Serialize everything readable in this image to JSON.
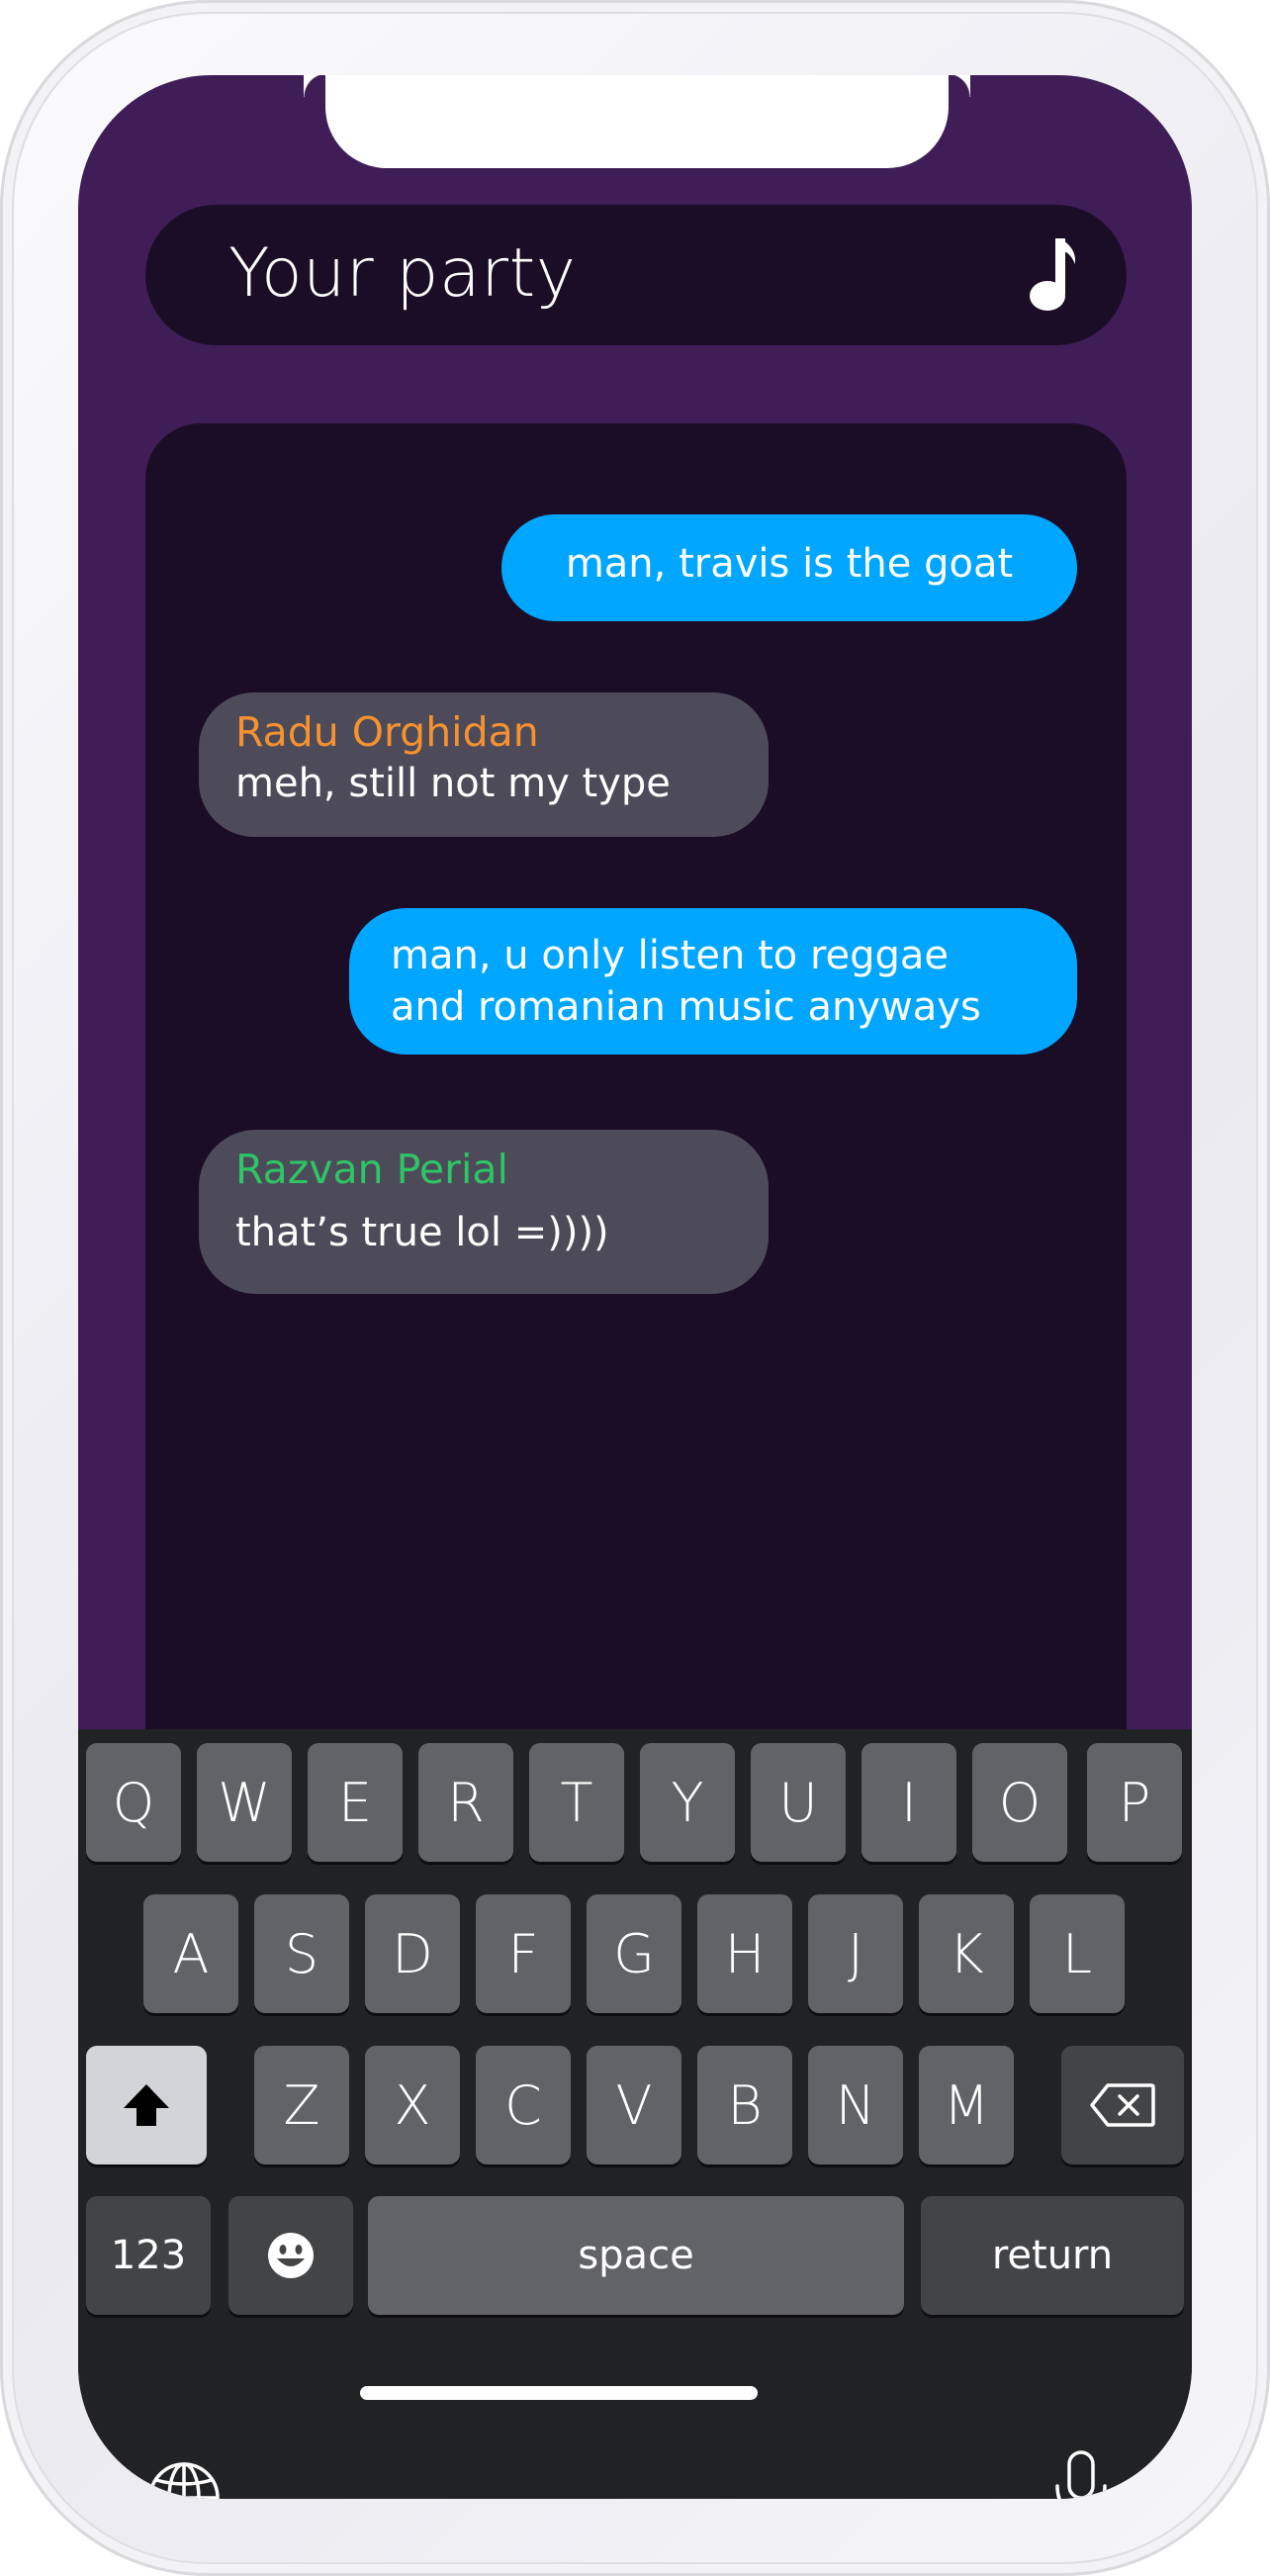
{
  "header": {
    "title": "Your party",
    "icon": "music-note-icon"
  },
  "messages": [
    {
      "sender": "",
      "text": "man, travis is the goat",
      "mine": true
    },
    {
      "sender": "Radu Orghidan",
      "sender_color": "#f5922f",
      "text": "meh, still not my type",
      "mine": false
    },
    {
      "sender": "",
      "text": "man, u only listen to reggae\nand romanian music anyways",
      "mine": true
    },
    {
      "sender": "Razvan Perial",
      "sender_color": "#2ec564",
      "text": "that’s true lol =))))",
      "mine": false
    }
  ],
  "keyboard": {
    "row1": [
      "Q",
      "W",
      "E",
      "R",
      "T",
      "Y",
      "U",
      "I",
      "O",
      "P"
    ],
    "row2": [
      "A",
      "S",
      "D",
      "F",
      "G",
      "H",
      "J",
      "K",
      "L"
    ],
    "row3": [
      "Z",
      "X",
      "C",
      "V",
      "B",
      "N",
      "M"
    ],
    "numbers_label": "123",
    "space_label": "space",
    "return_label": "return",
    "icons": [
      "shift-icon",
      "backspace-icon",
      "emoji-icon",
      "globe-icon",
      "microphone-icon"
    ]
  },
  "colors": {
    "background": "#3f1e57",
    "panel": "#1c0d26",
    "my_bubble": "#00a6ff",
    "their_bubble": "#4d4a5a",
    "keyboard": "#202224"
  }
}
